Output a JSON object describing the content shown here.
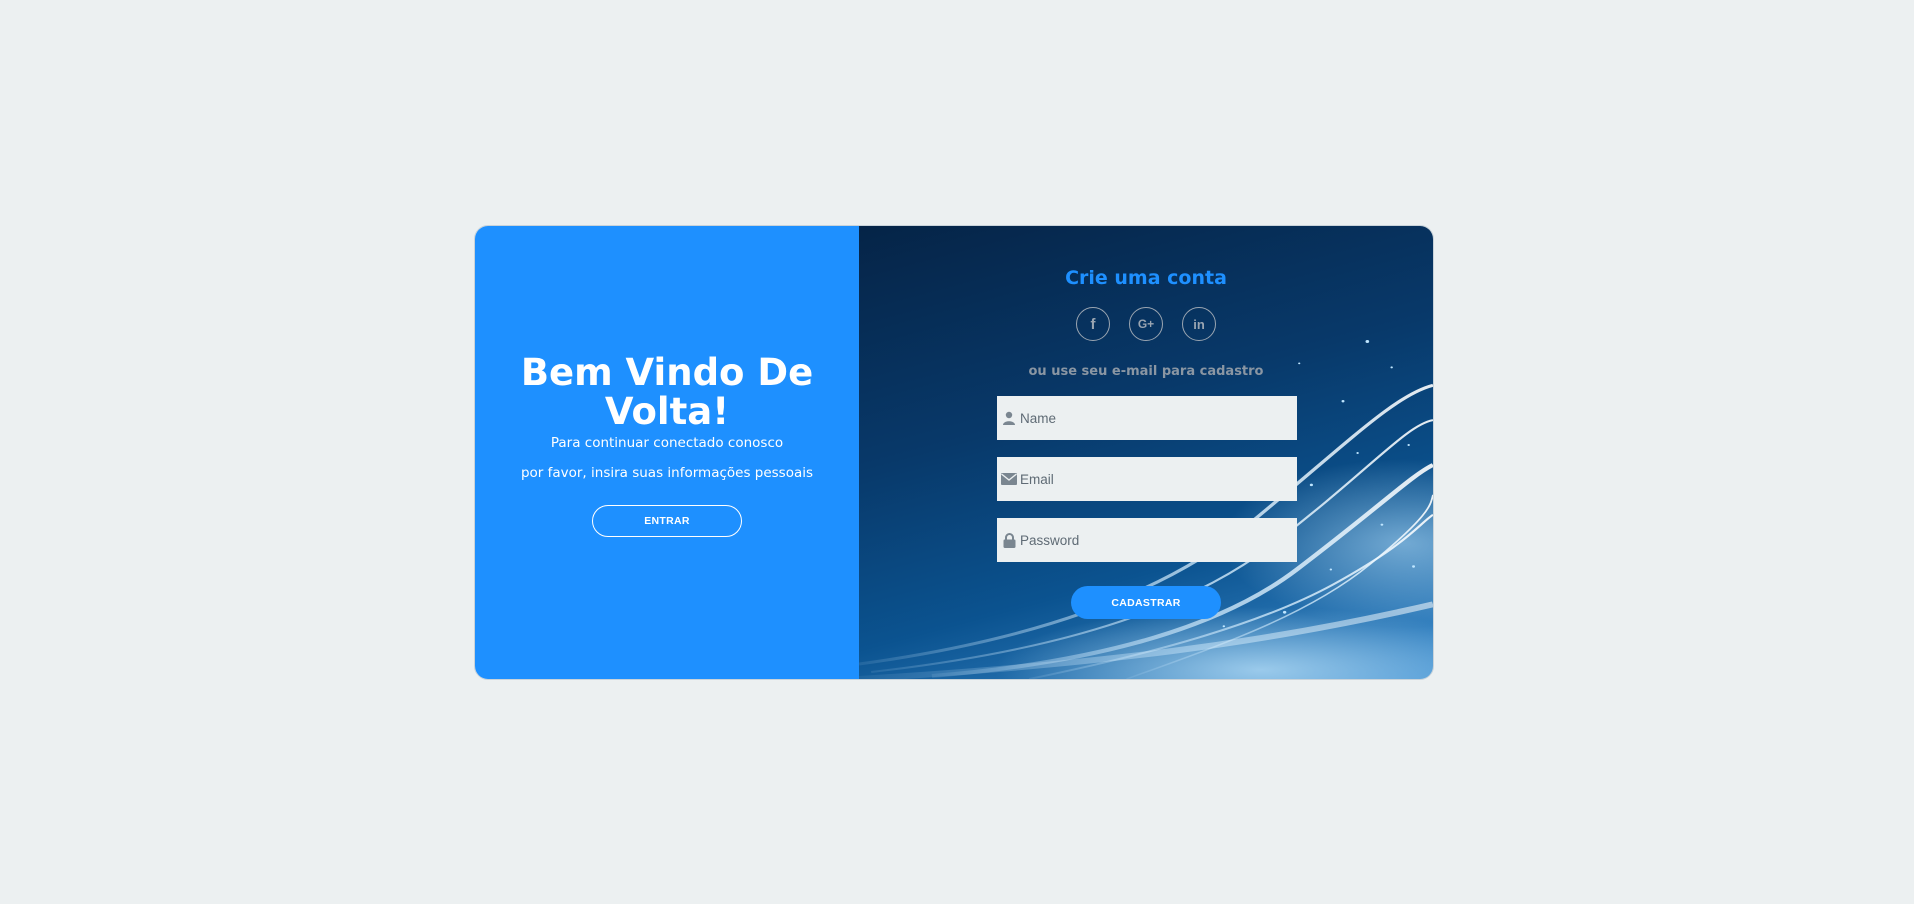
{
  "left_panel": {
    "title": "Bem Vindo De Volta!",
    "line1": "Para continuar conectado conosco",
    "line2": "por favor, insira suas informações pessoais",
    "button": "ENTRAR",
    "background": "#1e90ff"
  },
  "right_panel": {
    "title": "Crie uma conta",
    "subtitle": "ou use seu e-mail para cadastro",
    "socials": [
      {
        "icon": "facebook-icon",
        "glyph": "f"
      },
      {
        "icon": "google-plus-icon",
        "glyph": "G+"
      },
      {
        "icon": "linkedin-icon",
        "glyph": "in"
      }
    ],
    "fields": {
      "name": {
        "placeholder": "Name",
        "value": "",
        "icon": "user-icon"
      },
      "email": {
        "placeholder": "Email",
        "value": "",
        "icon": "envelope-icon"
      },
      "password": {
        "placeholder": "Password",
        "value": "",
        "icon": "lock-icon"
      }
    },
    "button": "CADASTRAR",
    "accent": "#1e90ff"
  }
}
